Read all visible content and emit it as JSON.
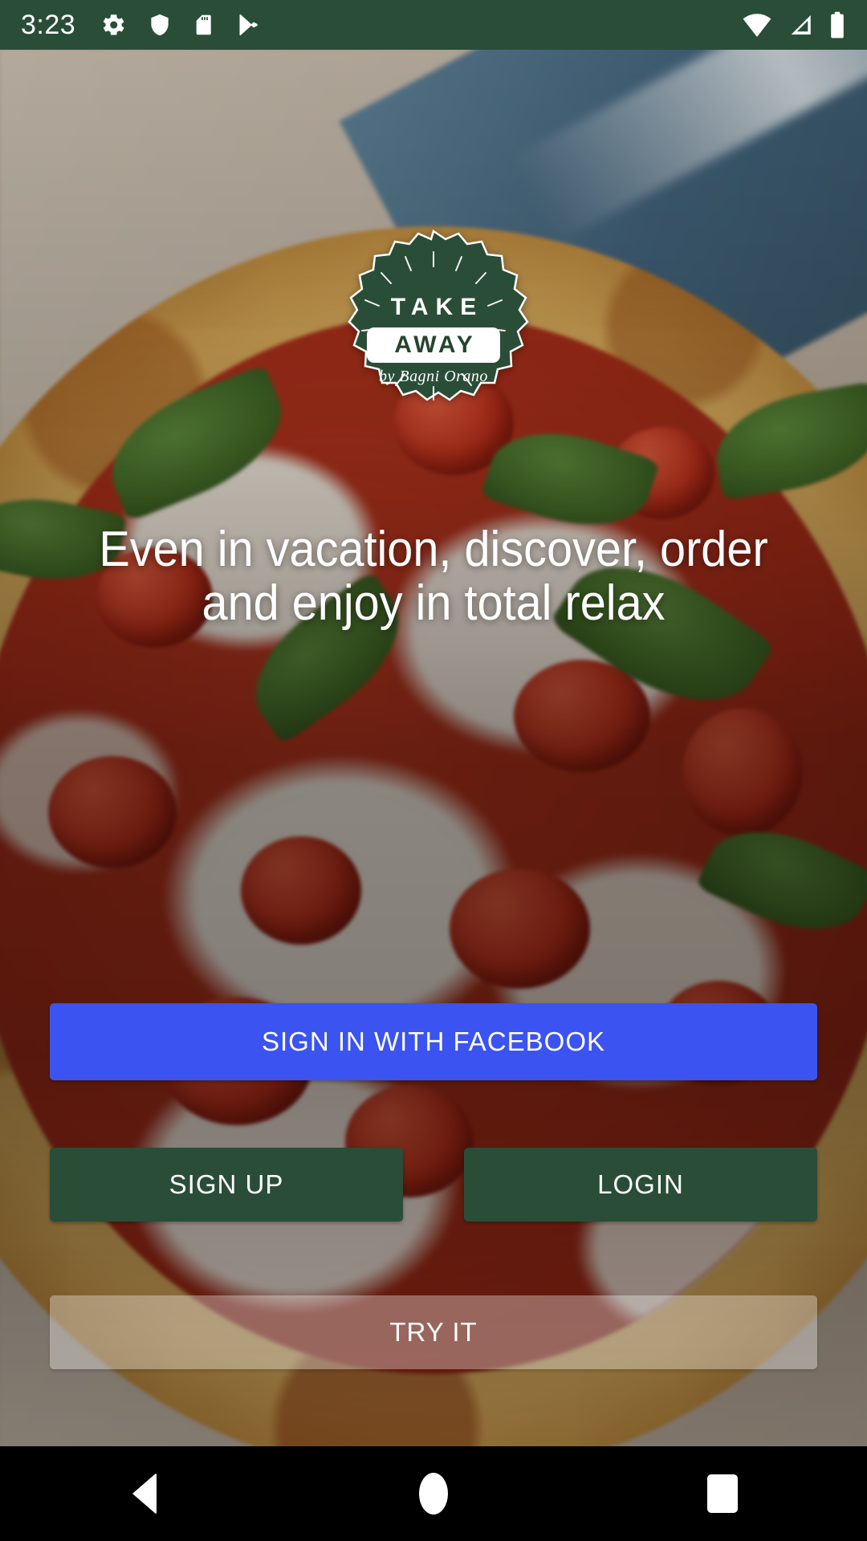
{
  "status_bar": {
    "time": "3:23",
    "background_color": "#2A4D38",
    "left_icons": [
      "gear-icon",
      "shield-icon",
      "sd-card-icon",
      "play-store-icon"
    ],
    "right_icons": [
      "wifi-icon",
      "cellular-signal-icon",
      "battery-full-icon"
    ]
  },
  "logo": {
    "line1": "TAKE",
    "line2": "AWAY",
    "tagline": "by Bagni Orano",
    "badge_color": "#2A4D38",
    "badge_text_color": "#FFFFFF"
  },
  "hero": {
    "headline": "Even in vacation, discover, order and enjoy in total relax"
  },
  "actions": {
    "facebook_label": "SIGN IN WITH FACEBOOK",
    "facebook_color": "#3B53F0",
    "signup_label": "SIGN UP",
    "login_label": "LOGIN",
    "secondary_color": "#2A4D38",
    "tryit_label": "TRY IT",
    "tryit_color": "rgba(255,255,255,0.33)"
  },
  "nav_bar": {
    "back": "back-icon",
    "home": "home-icon",
    "recents": "recents-icon",
    "background_color": "#000000"
  }
}
